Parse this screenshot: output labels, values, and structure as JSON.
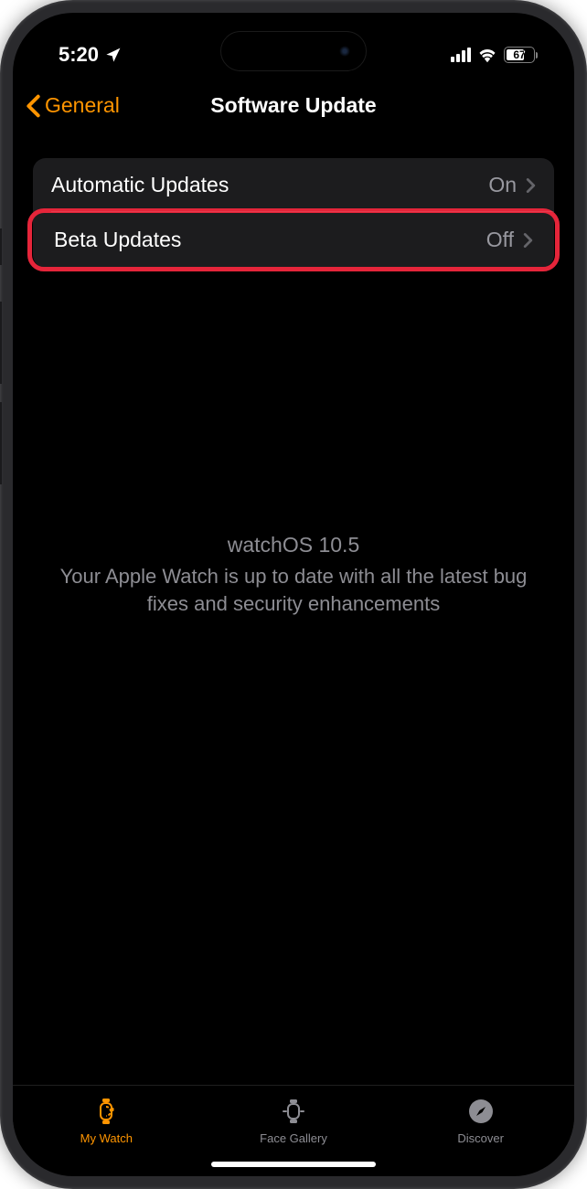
{
  "status_bar": {
    "time": "5:20",
    "battery_percent": "67"
  },
  "nav": {
    "back_label": "General",
    "title": "Software Update"
  },
  "rows": {
    "automatic": {
      "label": "Automatic Updates",
      "value": "On"
    },
    "beta": {
      "label": "Beta Updates",
      "value": "Off"
    }
  },
  "status": {
    "version": "watchOS 10.5",
    "message": "Your Apple Watch is up to date with all the latest bug fixes and security enhancements"
  },
  "tabs": {
    "my_watch": "My Watch",
    "face_gallery": "Face Gallery",
    "discover": "Discover"
  }
}
